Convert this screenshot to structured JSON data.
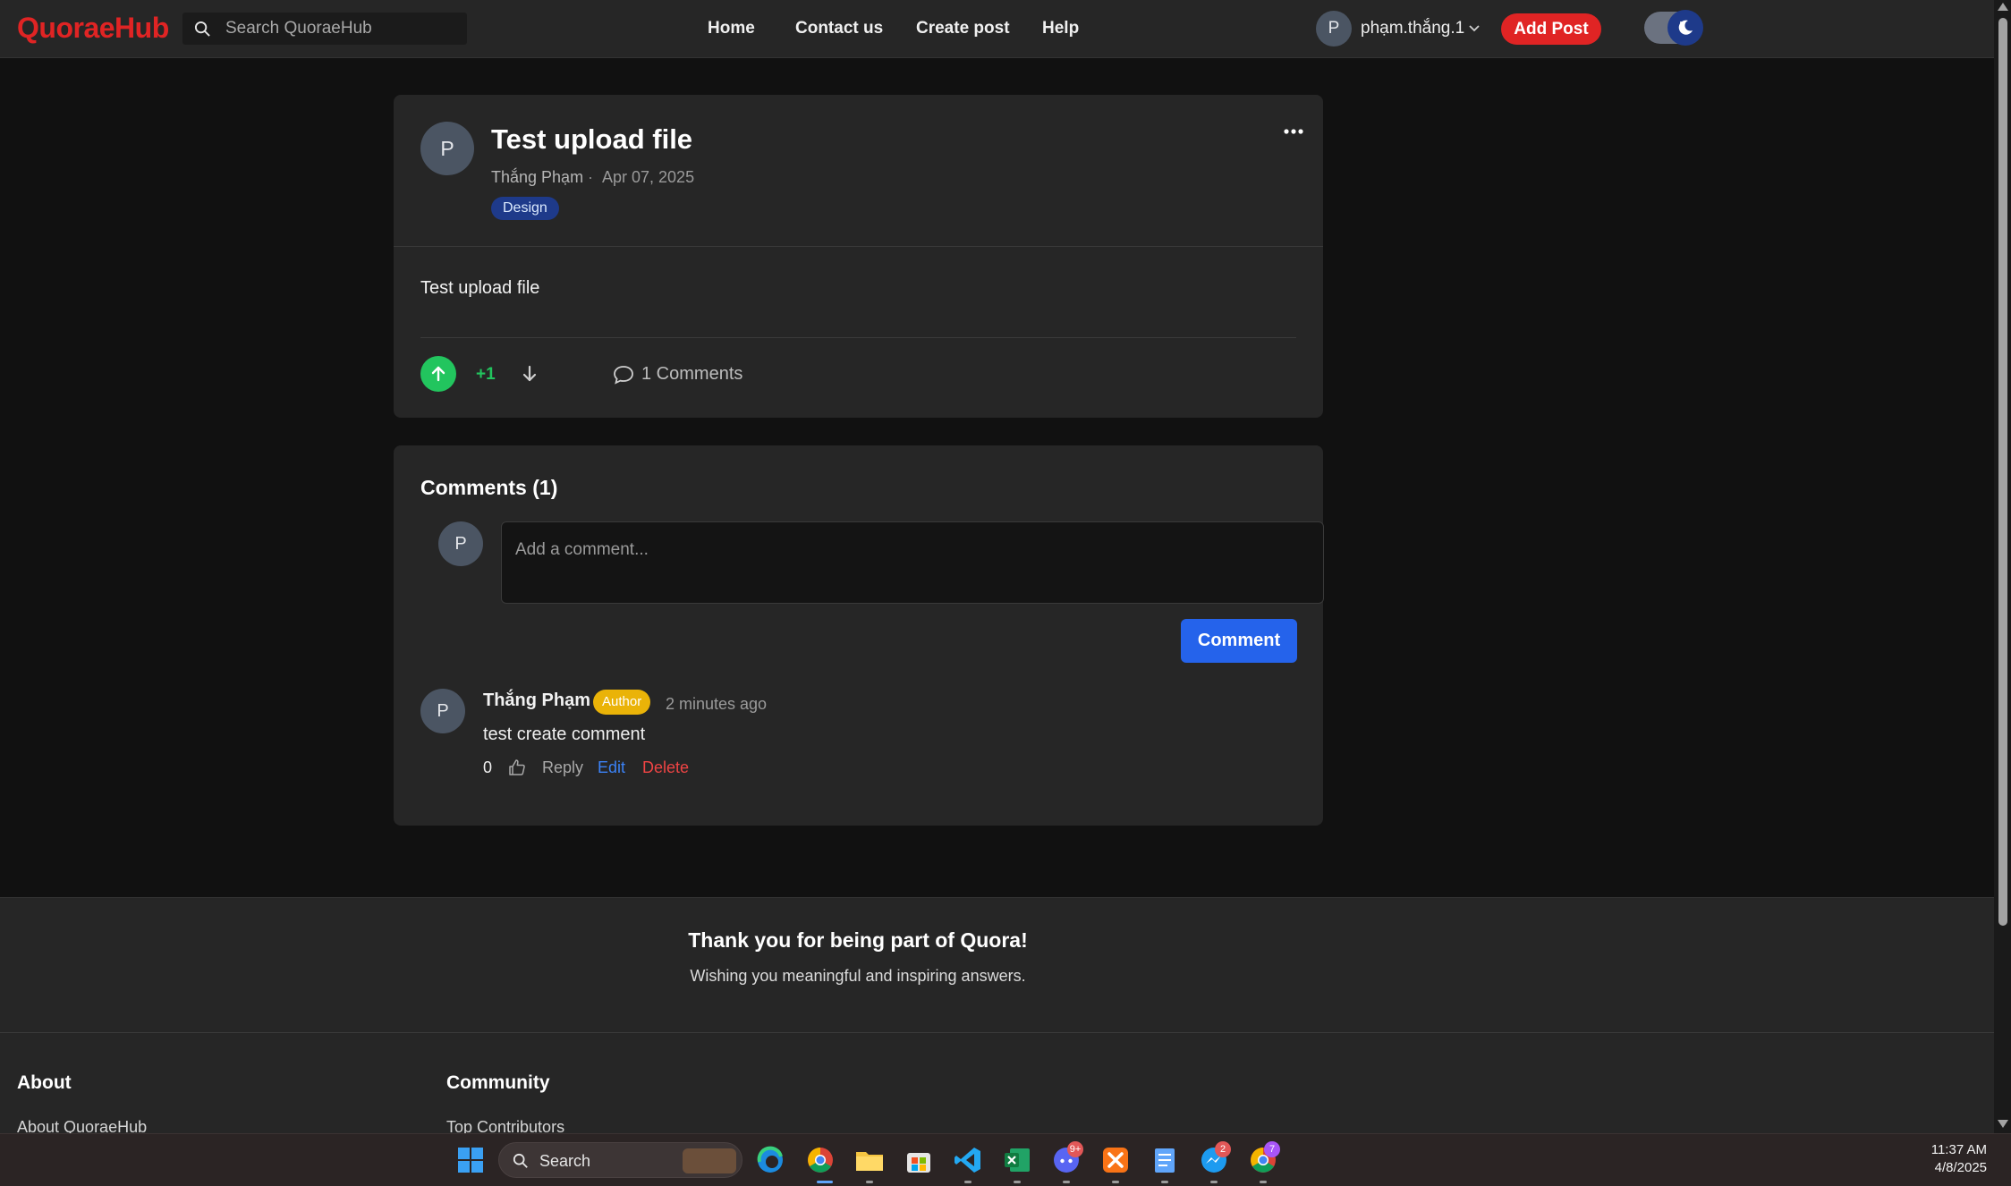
{
  "brand": {
    "logo": "QuoraeHub",
    "color": "#e02424"
  },
  "search": {
    "placeholder": "Search QuoraeHub"
  },
  "nav": {
    "links": [
      "Home",
      "Contact us",
      "Create post",
      "Help"
    ]
  },
  "user": {
    "avatar_initial": "P",
    "username": "phạm.thắng.1"
  },
  "header": {
    "add_post": "Add Post",
    "theme": "dark"
  },
  "post": {
    "avatar_initial": "P",
    "title": "Test upload file",
    "author": "Thắng Phạm",
    "separator": "·",
    "date": "Apr 07, 2025",
    "tag": "Design",
    "body": "Test upload file",
    "vote_count": "+1",
    "comments_link": "1 Comments"
  },
  "comments": {
    "heading": "Comments (1)",
    "current_user_initial": "P",
    "input_placeholder": "Add a comment...",
    "submit_label": "Comment",
    "items": [
      {
        "avatar_initial": "P",
        "author": "Thắng Phạm",
        "badge": "Author",
        "time": "2 minutes ago",
        "text": "test create comment",
        "likes": "0",
        "reply": "Reply",
        "edit": "Edit",
        "delete": "Delete"
      }
    ]
  },
  "footer": {
    "thanks": "Thank you for being part of Quora!",
    "wishing": "Wishing you meaningful and inspiring answers.",
    "columns": [
      {
        "heading": "About",
        "first_link": "About QuoraeHub"
      },
      {
        "heading": "Community",
        "first_link": "Top Contributors"
      }
    ]
  },
  "taskbar": {
    "search_label": "Search",
    "icons": [
      "windows-start-icon",
      "edge-icon",
      "chrome-icon",
      "file-explorer-icon",
      "store-icon",
      "vscode-icon",
      "excel-icon",
      "discord-icon",
      "xampp-icon",
      "notepad-icon",
      "messenger-icon",
      "chrome-profile-icon"
    ],
    "badges": {
      "discord": "9+",
      "messenger": "2",
      "chrome_profile": "7"
    },
    "time": "11:37 AM",
    "date": "4/8/2025"
  }
}
